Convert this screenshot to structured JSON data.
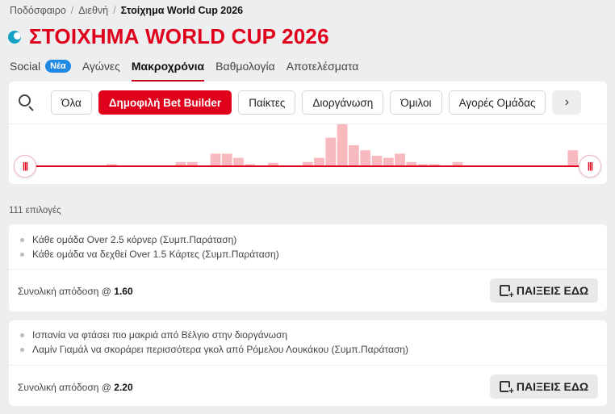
{
  "breadcrumb": [
    "Ποδόσφαιρο",
    "Διεθνή",
    "Στοίχημα World Cup 2026"
  ],
  "page_title": "ΣΤΟΙΧΗΜΑ WORLD CUP 2026",
  "tabs": [
    {
      "label": "Social",
      "badge": "Νέα"
    },
    {
      "label": "Αγώνες"
    },
    {
      "label": "Μακροχρόνια",
      "active": true
    },
    {
      "label": "Βαθμολογία"
    },
    {
      "label": "Αποτελέσματα"
    }
  ],
  "filters": [
    "Όλα",
    "Δημοφιλή Bet Builder",
    "Παίκτες",
    "Διοργάνωση",
    "Όμιλοι",
    "Αγορές Ομάδας"
  ],
  "active_filter": "Δημοφιλή Bet Builder",
  "histogram": {
    "bars": [
      0,
      0,
      0,
      0,
      0,
      0,
      0,
      0.05,
      0,
      0,
      0,
      0,
      0,
      0.1,
      0.1,
      0,
      0.3,
      0.3,
      0.2,
      0.05,
      0,
      0.08,
      0,
      0,
      0.1,
      0.2,
      0.68,
      1.0,
      0.5,
      0.38,
      0.25,
      0.2,
      0.3,
      0.1,
      0.05,
      0.05,
      0,
      0.1,
      0,
      0,
      0,
      0,
      0,
      0,
      0,
      0,
      0,
      0.38,
      0
    ]
  },
  "count_label": "111 επιλογές",
  "bets": [
    {
      "legs": [
        "Κάθε ομάδα Over 2.5 κόρνερ (Συμπ.Παράταση)",
        "Κάθε ομάδα να δεχθεί Over 1.5 Κάρτες (Συμπ.Παράταση)"
      ],
      "total_label": "Συνολική απόδοση @",
      "odds": "1.60",
      "button": "ΠΑΙΞΕΙΣ ΕΔΩ"
    },
    {
      "legs": [
        "Ισπανία να φτάσει πιο μακριά από Βέλγιο στην διοργάνωση",
        "Λαμίν Γιαμάλ να σκοράρει περισσότερα γκολ από Ρόμελου Λουκάκου (Συμπ.Παράταση)"
      ],
      "total_label": "Συνολική απόδοση @",
      "odds": "2.20",
      "button": "ΠΑΙΞΕΙΣ ΕΔΩ"
    }
  ],
  "colors": {
    "accent": "#e0001b",
    "bar": "#f8b9bf",
    "badge": "#1e88e5"
  },
  "icons": {
    "title": "globe-icon",
    "search": "search-icon",
    "arrow": "chevron-right-icon",
    "slider": "slider-handle-icon",
    "slip": "betslip-add-icon"
  }
}
